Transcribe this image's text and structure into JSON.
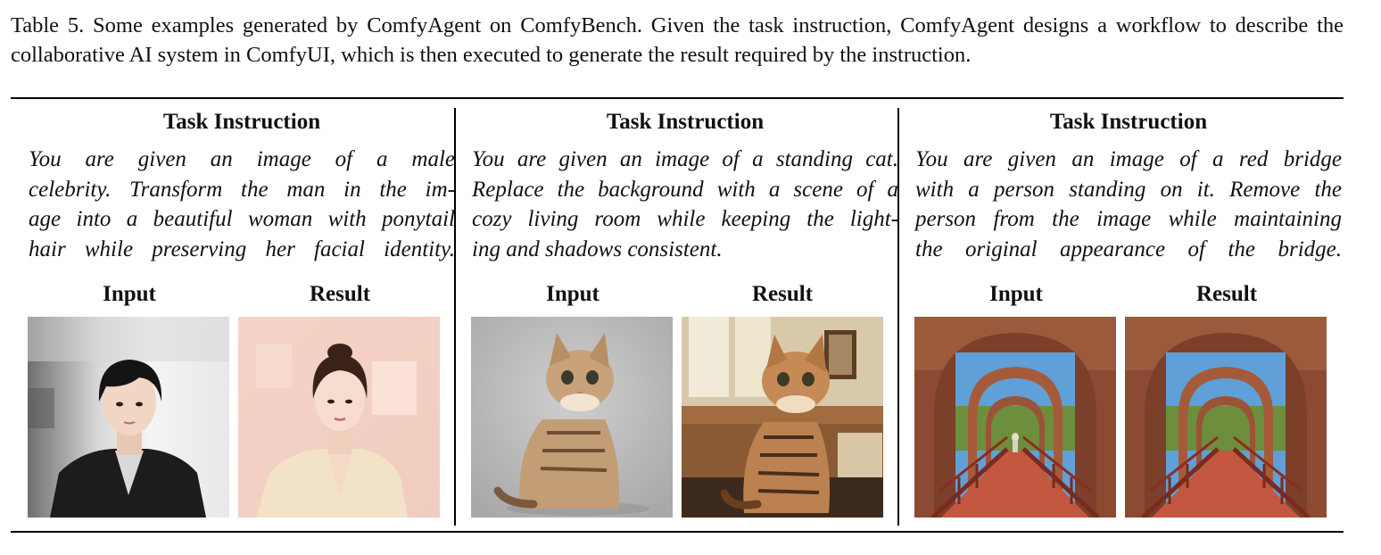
{
  "caption": "Table 5. Some examples generated by ComfyAgent on ComfyBench. Given the task instruction, ComfyAgent designs a workflow to describe the collaborative AI system in ComfyUI, which is then executed to generate the result required by the instruction.",
  "columns": [
    {
      "title": "Task Instruction",
      "instruction_lines": [
        "You are given an image of a male",
        "celebrity. Transform the man in the im-",
        "age into a beautiful woman with ponytail",
        "hair while preserving her facial identity."
      ],
      "input_label": "Input",
      "result_label": "Result"
    },
    {
      "title": "Task Instruction",
      "instruction_lines": [
        "You are given an image of a standing cat.",
        "Replace the background with a scene of a",
        "cozy living room while keeping the light-",
        "ing and shadows consistent."
      ],
      "input_label": "Input",
      "result_label": "Result"
    },
    {
      "title": "Task Instruction",
      "instruction_lines": [
        "You are given an image of a red bridge",
        "with a person standing on it. Remove the",
        "person from the image while maintaining",
        "the original appearance of the bridge."
      ],
      "input_label": "Input",
      "result_label": "Result"
    }
  ]
}
